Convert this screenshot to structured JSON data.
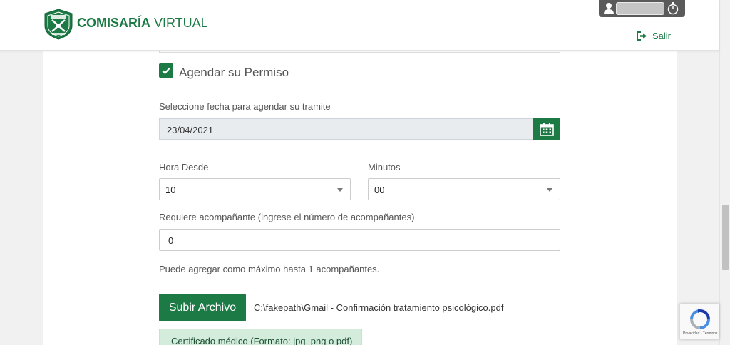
{
  "header": {
    "brand_bold": "COMISARÍA",
    "brand_light": " VIRTUAL",
    "logout_label": "Salir"
  },
  "form": {
    "schedule_checkbox": {
      "label": "Agendar su Permiso",
      "checked": true
    },
    "date": {
      "label": "Seleccione fecha para agendar su tramite",
      "value": "23/04/2021"
    },
    "hour": {
      "label": "Hora Desde",
      "value": "10"
    },
    "minutes": {
      "label": "Minutos",
      "value": "00"
    },
    "companions": {
      "label": "Requiere acompañante (ingrese el número de acompañantes)",
      "value": "0",
      "help": "Puede agregar como máximo hasta 1 acompañantes."
    },
    "upload": {
      "button_label": "Subir Archivo",
      "filename": "C:\\fakepath\\Gmail - Confirmación tratamiento psicológico.pdf",
      "certificate_note": "Certificado médico (Formato: jpg, png o pdf)"
    }
  },
  "recaptcha": {
    "footer": "Privacidad - Términos"
  },
  "colors": {
    "primary_green": "#1c7a45",
    "success_bg": "#d3ecdc"
  }
}
